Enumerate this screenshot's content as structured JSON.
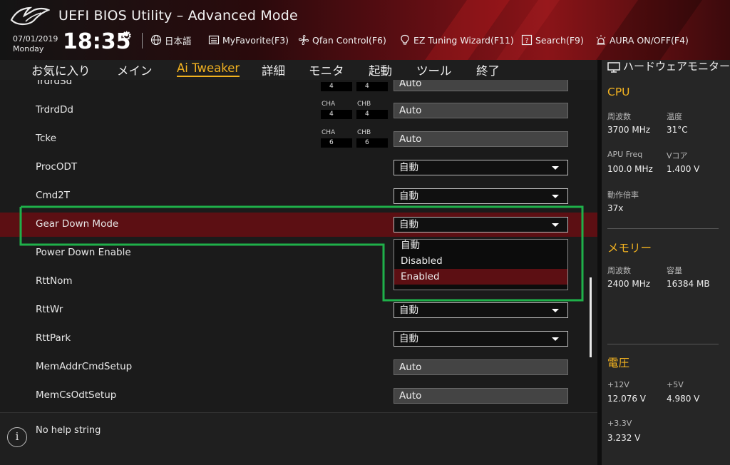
{
  "header": {
    "title": "UEFI BIOS Utility – Advanced Mode",
    "date": "07/01/2019",
    "day": "Monday",
    "time": "18:35",
    "items": [
      {
        "label": "日本語",
        "icon": "globe-icon"
      },
      {
        "label": "MyFavorite(F3)",
        "icon": "favorite-list-icon"
      },
      {
        "label": "Qfan Control(F6)",
        "icon": "fan-icon"
      },
      {
        "label": "EZ Tuning Wizard(F11)",
        "icon": "lightbulb-icon"
      },
      {
        "label": "Search(F9)",
        "icon": "search-question-icon"
      },
      {
        "label": "AURA ON/OFF(F4)",
        "icon": "aura-light-icon"
      }
    ]
  },
  "nav": {
    "tabs": [
      {
        "label": "お気に入り"
      },
      {
        "label": "メイン"
      },
      {
        "label": "Ai Tweaker",
        "active": true
      },
      {
        "label": "詳細"
      },
      {
        "label": "モニタ"
      },
      {
        "label": "起動"
      },
      {
        "label": "ツール"
      },
      {
        "label": "終了"
      }
    ]
  },
  "settings": {
    "partial_row": {
      "label": "TrdrdSd",
      "cha": "4",
      "chb": "4",
      "value": "Auto"
    },
    "rows": [
      {
        "label": "TrdrdDd",
        "cha_label": "CHA",
        "chb_label": "CHB",
        "cha": "4",
        "chb": "4",
        "value": "Auto",
        "type": "text"
      },
      {
        "label": "Tcke",
        "cha_label": "CHA",
        "chb_label": "CHB",
        "cha": "6",
        "chb": "6",
        "value": "Auto",
        "type": "text"
      },
      {
        "label": "ProcODT",
        "value": "自動",
        "type": "dropdown"
      },
      {
        "label": "Cmd2T",
        "value": "自動",
        "type": "dropdown"
      },
      {
        "label": "Gear Down Mode",
        "value": "自動",
        "type": "dropdown",
        "highlighted": true
      },
      {
        "label": "Power Down Enable",
        "value": "",
        "type": "hidden"
      },
      {
        "label": "RttNom",
        "value": "",
        "type": "hidden"
      },
      {
        "label": "RttWr",
        "value": "自動",
        "type": "dropdown"
      },
      {
        "label": "RttPark",
        "value": "自動",
        "type": "dropdown"
      },
      {
        "label": "MemAddrCmdSetup",
        "value": "Auto",
        "type": "text"
      },
      {
        "label": "MemCsOdtSetup",
        "value": "Auto",
        "type": "text"
      }
    ],
    "dropdown_menu": {
      "options": [
        "自動",
        "Disabled",
        "Enabled"
      ],
      "selected": "Enabled"
    }
  },
  "help": {
    "text": "No help string"
  },
  "hw_monitor": {
    "title": "ハードウェアモニター",
    "cpu": {
      "heading": "CPU",
      "freq_label": "周波数",
      "freq": "3700 MHz",
      "temp_label": "温度",
      "temp": "31°C",
      "apu_label": "APU Freq",
      "apu": "100.0 MHz",
      "vcore_label": "Vコア",
      "vcore": "1.400 V",
      "ratio_label": "動作倍率",
      "ratio": "37x"
    },
    "memory": {
      "heading": "メモリー",
      "freq_label": "周波数",
      "freq": "2400 MHz",
      "cap_label": "容量",
      "cap": "16384 MB"
    },
    "voltage": {
      "heading": "電圧",
      "v12_label": "+12V",
      "v12": "12.076 V",
      "v5_label": "+5V",
      "v5": "4.980 V",
      "v33_label": "+3.3V",
      "v33": "3.232 V"
    }
  },
  "colors": {
    "accent": "#f2b220",
    "highlight_row": "#5c0f13",
    "annotation_box": "#1fb04a"
  }
}
